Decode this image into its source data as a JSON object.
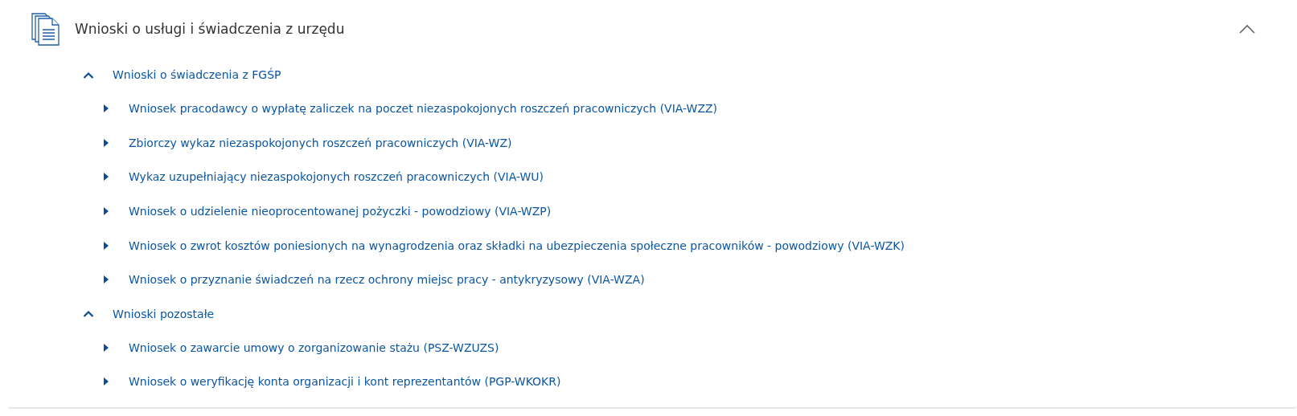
{
  "section": {
    "title": "Wnioski o usługi i świadczenia z urzędu",
    "expanded": true,
    "groups": [
      {
        "label": "Wnioski o świadczenia z FGŚP",
        "expanded": true,
        "children": [
          {
            "label": "Wniosek pracodawcy o wypłatę zaliczek na poczet niezaspokojonych roszczeń pracowniczych (VIA-WZZ)"
          },
          {
            "label": "Zbiorczy wykaz niezaspokojonych roszczeń pracowniczych (VIA-WZ)"
          },
          {
            "label": "Wykaz uzupełniający niezaspokojonych roszczeń pracowniczych (VIA-WU)"
          },
          {
            "label": "Wniosek o udzielenie nieoprocentowanej pożyczki - powodziowy (VIA-WZP)"
          },
          {
            "label": "Wniosek o zwrot kosztów poniesionych na wynagrodzenia oraz składki na ubezpieczenia społeczne pracowników - powodziowy (VIA-WZK)"
          },
          {
            "label": "Wniosek o przyznanie świadczeń na rzecz ochrony miejsc pracy - antykryzysowy (VIA-WZA)"
          }
        ]
      },
      {
        "label": "Wnioski pozostałe",
        "expanded": true,
        "children": [
          {
            "label": "Wniosek o zawarcie umowy o zorganizowanie stażu (PSZ-WZUZS)"
          },
          {
            "label": "Wniosek o weryfikację konta organizacji i kont reprezentantów (PGP-WKOKR)"
          }
        ]
      }
    ]
  }
}
